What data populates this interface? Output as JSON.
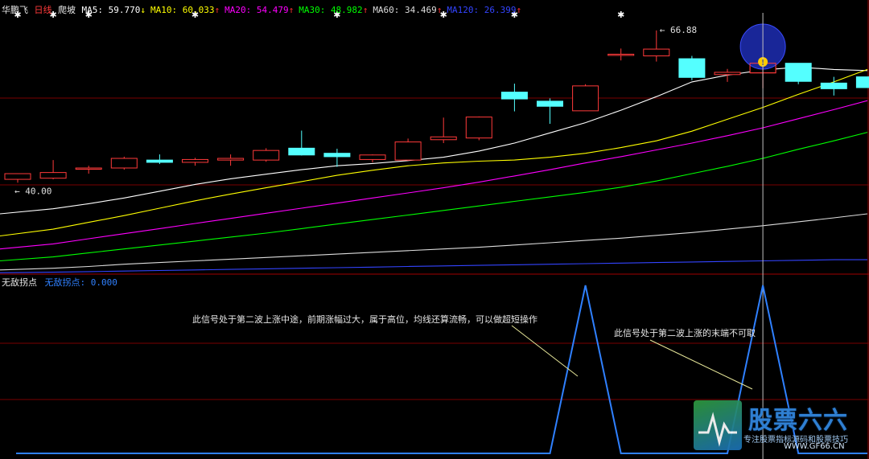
{
  "header": {
    "stock_name": "华鹏飞",
    "period": "日线",
    "mode": "爬坡",
    "ma_items": [
      {
        "label": "MA5: 59.770",
        "arrow": "↓",
        "color": "#ffffff",
        "arrow_color": "#ffff00"
      },
      {
        "label": "MA10: 60.033",
        "arrow": "↑",
        "color": "#ffff00",
        "arrow_color": "#ff3030"
      },
      {
        "label": "MA20: 54.479",
        "arrow": "↑",
        "color": "#ff00ff",
        "arrow_color": "#ff3030"
      },
      {
        "label": "MA30: 48.982",
        "arrow": "↑",
        "color": "#00ff00",
        "arrow_color": "#ff3030"
      },
      {
        "label": "MA60: 34.469",
        "arrow": "↑",
        "color": "#dddddd",
        "arrow_color": "#ff3030"
      },
      {
        "label": "MA120: 26.399",
        "arrow": "↑",
        "color": "#3344ff",
        "arrow_color": "#ff3030"
      }
    ]
  },
  "sub_header": {
    "name": "无敌拐点",
    "value_label": "无敌拐点: 0.000"
  },
  "annotations": {
    "note1": "此信号处于第二波上涨中途，前期涨幅过大，属于高位，均线还算流畅，可以做超短操作",
    "note2": "此信号处于第二波上涨的末端不可取"
  },
  "watermark": {
    "title": "股票六六",
    "subtitle": "专注股票指标源码和股票技巧",
    "url": "WWW.GF66.CN"
  },
  "colors": {
    "up": "#ff3a3a",
    "down": "#54ffff",
    "grid": "#7a0000",
    "crosshair": "#c0c0c0",
    "indicator": "#2f80ff"
  },
  "chart_data": {
    "type": "candlestick",
    "price_labels": {
      "high": "66.88",
      "low": "40.00"
    },
    "candles": [
      {
        "o": 40.6,
        "h": 41.3,
        "l": 40.0,
        "c": 41.6
      },
      {
        "o": 40.8,
        "h": 44.0,
        "l": 40.6,
        "c": 41.8
      },
      {
        "o": 42.4,
        "h": 43.0,
        "l": 41.6,
        "c": 42.6
      },
      {
        "o": 42.6,
        "h": 44.6,
        "l": 42.3,
        "c": 44.3
      },
      {
        "o": 44.0,
        "h": 45.0,
        "l": 43.3,
        "c": 43.6
      },
      {
        "o": 43.6,
        "h": 44.4,
        "l": 43.0,
        "c": 44.1
      },
      {
        "o": 44.0,
        "h": 45.0,
        "l": 43.0,
        "c": 44.3
      },
      {
        "o": 44.0,
        "h": 46.1,
        "l": 43.7,
        "c": 45.7
      },
      {
        "o": 46.1,
        "h": 49.2,
        "l": 44.8,
        "c": 44.9
      },
      {
        "o": 45.2,
        "h": 46.0,
        "l": 42.8,
        "c": 44.6
      },
      {
        "o": 44.1,
        "h": 45.0,
        "l": 43.6,
        "c": 44.9
      },
      {
        "o": 44.0,
        "h": 47.8,
        "l": 43.9,
        "c": 47.2
      },
      {
        "o": 47.6,
        "h": 51.5,
        "l": 47.0,
        "c": 48.1
      },
      {
        "o": 47.9,
        "h": 51.7,
        "l": 47.5,
        "c": 51.6
      },
      {
        "o": 56.0,
        "h": 57.5,
        "l": 52.6,
        "c": 54.8
      },
      {
        "o": 54.4,
        "h": 54.9,
        "l": 50.4,
        "c": 53.5
      },
      {
        "o": 52.7,
        "h": 57.4,
        "l": 52.7,
        "c": 57.1
      },
      {
        "o": 62.5,
        "h": 63.7,
        "l": 61.6,
        "c": 62.7
      },
      {
        "o": 62.4,
        "h": 66.9,
        "l": 61.4,
        "c": 63.6
      },
      {
        "o": 61.9,
        "h": 62.4,
        "l": 58.1,
        "c": 58.6
      },
      {
        "o": 59.1,
        "h": 60.1,
        "l": 57.8,
        "c": 59.5
      },
      {
        "o": 59.4,
        "h": 61.5,
        "l": 56.7,
        "c": 61.1
      },
      {
        "o": 61.1,
        "h": 61.1,
        "l": 57.4,
        "c": 57.9
      },
      {
        "o": 57.6,
        "h": 58.7,
        "l": 55.4,
        "c": 56.6
      },
      {
        "o": 58.7,
        "h": 58.9,
        "l": 56.8,
        "c": 56.8
      }
    ],
    "ma_lines": [
      {
        "name": "MA5",
        "color": "#ffffff",
        "values": [
          34.5,
          35.4,
          36.3,
          37.3,
          38.5,
          39.7,
          40.7,
          41.5,
          42.3,
          43.0,
          43.4,
          43.9,
          44.5,
          45.6,
          47.0,
          48.8,
          50.6,
          52.8,
          55.2,
          57.8,
          59.0,
          59.9,
          60.4,
          60.0,
          59.8
        ]
      },
      {
        "name": "MA10",
        "color": "#ffff00",
        "values": [
          30.6,
          31.8,
          33.0,
          34.2,
          35.5,
          36.8,
          38.0,
          39.1,
          40.2,
          41.3,
          42.2,
          43.0,
          43.5,
          43.8,
          44.0,
          44.5,
          45.2,
          46.2,
          47.4,
          49.1,
          51.2,
          53.3,
          55.6,
          57.8,
          60.0
        ]
      },
      {
        "name": "MA20",
        "color": "#ff00ff",
        "values": [
          28.3,
          29.2,
          30.1,
          31.0,
          31.9,
          32.8,
          33.7,
          34.6,
          35.5,
          36.4,
          37.3,
          38.2,
          39.1,
          40.1,
          41.2,
          42.3,
          43.5,
          44.6,
          45.8,
          47.0,
          48.3,
          49.7,
          51.3,
          52.9,
          54.5
        ]
      },
      {
        "name": "MA30",
        "color": "#00ff00",
        "values": [
          26.2,
          26.9,
          27.6,
          28.3,
          29.0,
          29.7,
          30.4,
          31.1,
          31.9,
          32.7,
          33.5,
          34.3,
          35.1,
          35.9,
          36.7,
          37.5,
          38.3,
          39.2,
          40.3,
          41.6,
          42.9,
          44.3,
          45.9,
          47.4,
          48.9
        ]
      },
      {
        "name": "MA60",
        "color": "#dddddd",
        "values": [
          24.6,
          24.9,
          25.2,
          25.6,
          25.9,
          26.2,
          26.5,
          26.8,
          27.1,
          27.4,
          27.7,
          28.0,
          28.3,
          28.6,
          29.0,
          29.4,
          29.8,
          30.2,
          30.7,
          31.2,
          31.8,
          32.4,
          33.1,
          33.8,
          34.5
        ]
      },
      {
        "name": "MA120",
        "color": "#3344ff",
        "values": [
          24.1,
          24.2,
          24.3,
          24.4,
          24.5,
          24.6,
          24.7,
          24.8,
          24.9,
          25.0,
          25.1,
          25.2,
          25.3,
          25.4,
          25.5,
          25.6,
          25.7,
          25.8,
          25.9,
          26.0,
          26.1,
          26.2,
          26.3,
          26.4,
          26.4
        ]
      }
    ],
    "star_marks": [
      0,
      1,
      2,
      5,
      9,
      12,
      14,
      17
    ],
    "signal_index": 21,
    "signal_label": "!",
    "indicator": {
      "name": "无敌拐点",
      "values": [
        0,
        0,
        0,
        0,
        0,
        0,
        0,
        0,
        0,
        0,
        0,
        0,
        0,
        0,
        0,
        0,
        1,
        0,
        0,
        0,
        0,
        1,
        0,
        0,
        0
      ]
    }
  }
}
